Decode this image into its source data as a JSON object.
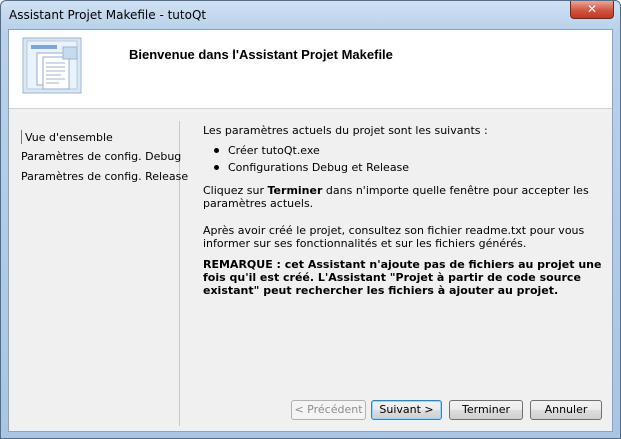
{
  "window": {
    "title": "Assistant Projet Makefile - tutoQt",
    "close_glyph": "✕"
  },
  "header": {
    "title": "Bienvenue dans l'Assistant Projet Makefile",
    "icon": "wizard-pages-icon"
  },
  "nav": {
    "items": [
      {
        "label": "Vue d'ensemble",
        "selected": true
      },
      {
        "label": "Paramètres de config. Debug",
        "selected": false
      },
      {
        "label": "Paramètres de config. Release",
        "selected": false
      }
    ]
  },
  "content": {
    "intro": "Les paramètres actuels du projet sont les suivants :",
    "bullets": [
      "Créer tutoQt.exe",
      "Configurations Debug et Release"
    ],
    "finish_pre": "Cliquez sur ",
    "finish_bold": "Terminer",
    "finish_post": " dans n'importe quelle fenêtre pour accepter les paramètres actuels.",
    "after": "Après avoir créé le projet, consultez son fichier readme.txt pour vous informer sur ses fonctionnalités et sur les fichiers générés.",
    "note": "REMARQUE : cet Assistant n'ajoute pas de fichiers au projet une fois qu'il est créé. L'Assistant \"Projet à partir de code source existant\" peut rechercher les fichiers à ajouter au projet."
  },
  "buttons": {
    "previous": "< Précédent",
    "next": "Suivant >",
    "finish": "Terminer",
    "cancel": "Annuler"
  }
}
